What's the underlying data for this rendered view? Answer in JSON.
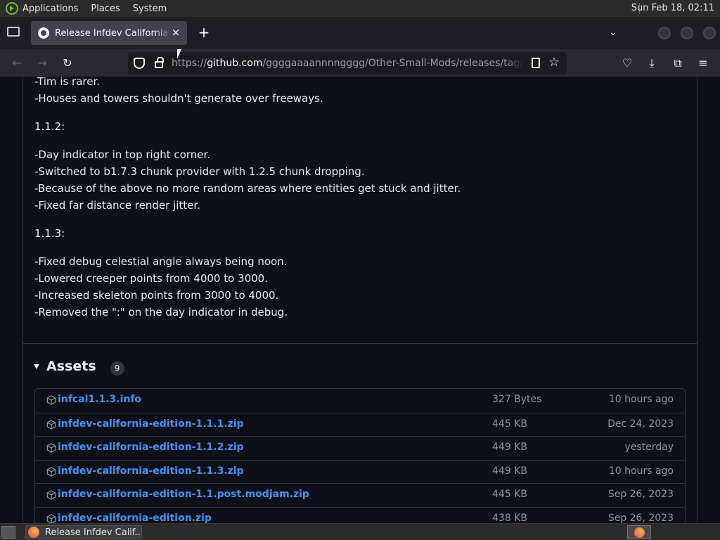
{
  "panel": {
    "menus": [
      "Applications",
      "Places",
      "System"
    ],
    "clock": "Sun Feb 18, 02:11"
  },
  "tab": {
    "title": "Release Infdev California Edition",
    "close": "×"
  },
  "tabstrip": {
    "new_tab": "+",
    "overflow": "⌄"
  },
  "navbar": {
    "back": "←",
    "forward": "→",
    "reload": "↻",
    "url_prefix": "https://",
    "url_host": "github.com",
    "url_path": "/ggggaaaannnngggg/Other-Small-Mods/releases/tag/californ",
    "star": "☆",
    "pocket": "♡",
    "download": "⤓",
    "extensions": "⧉",
    "menu": "≡"
  },
  "notes": {
    "block1": [
      "-Tim is rarer.",
      "-Houses and towers shouldn't generate over freeways."
    ],
    "v112": "1.1.2:",
    "block2": [
      "-Day indicator in top right corner.",
      "-Switched to b1.7.3 chunk provider with 1.2.5 chunk dropping.",
      "-Because of the above no more random areas where entities get stuck and jitter.",
      "-Fixed far distance render jitter."
    ],
    "v113": "1.1.3:",
    "block3": [
      "-Fixed debug celestial angle always being noon.",
      "-Lowered creeper points from 4000 to 3000.",
      "-Increased skeleton points from 3000 to 4000.",
      "-Removed the \":\" on the day indicator in debug."
    ]
  },
  "assets": {
    "title": "Assets",
    "count": "9",
    "rows": [
      {
        "name": "infcal1.1.3.info",
        "size": "327 Bytes",
        "date": "10 hours ago"
      },
      {
        "name": "infdev-california-edition-1.1.1.zip",
        "size": "445 KB",
        "date": "Dec 24, 2023"
      },
      {
        "name": "infdev-california-edition-1.1.2.zip",
        "size": "449 KB",
        "date": "yesterday"
      },
      {
        "name": "infdev-california-edition-1.1.3.zip",
        "size": "449 KB",
        "date": "10 hours ago"
      },
      {
        "name": "infdev-california-edition-1.1.post.modjam.zip",
        "size": "445 KB",
        "date": "Sep 26, 2023"
      },
      {
        "name": "infdev-california-edition.zip",
        "size": "438 KB",
        "date": "Sep 26, 2023"
      }
    ]
  },
  "taskbar": {
    "task_label": "Release Infdev Calif..."
  },
  "colors": {
    "page_bg": "#0d1117",
    "link": "#4493f8",
    "border": "#30363d",
    "muted": "#8d96a0"
  }
}
